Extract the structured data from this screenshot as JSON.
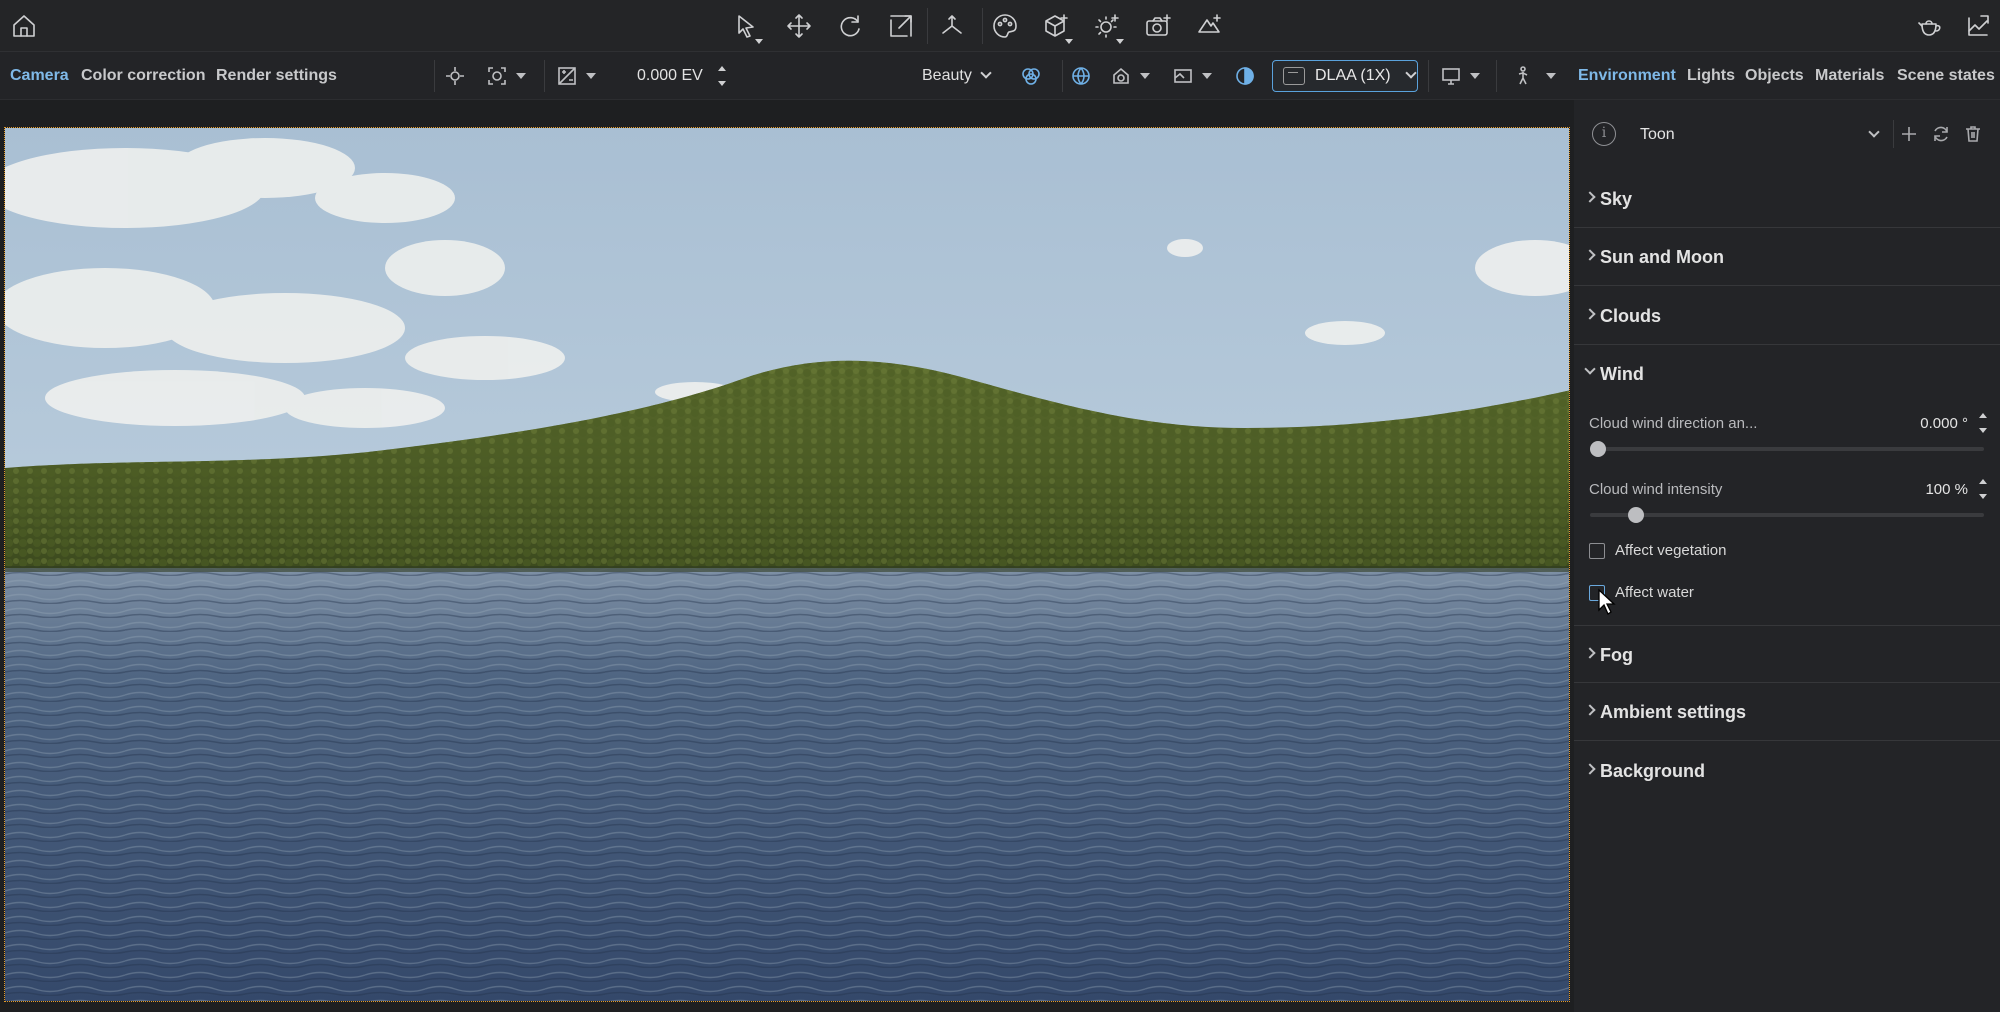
{
  "top_toolbar": {
    "icons": [
      "home-icon",
      "select-icon",
      "move-icon",
      "rotate-icon",
      "scale-icon",
      "transform-icon",
      "palette-icon",
      "add-object-icon",
      "add-light-icon",
      "add-camera-icon",
      "add-tree-icon",
      "teapot-icon",
      "image-edit-icon"
    ]
  },
  "left_tabs": [
    "Camera",
    "Color correction",
    "Render settings"
  ],
  "viewport_bar": {
    "exposure": "0.000 EV",
    "render_mode": "Beauty",
    "antialiasing": "DLAA (1X)"
  },
  "right_tabs": [
    "Environment",
    "Lights",
    "Objects",
    "Materials",
    "Scene states"
  ],
  "preset": {
    "name": "Toon"
  },
  "sections": [
    {
      "title": "Sky",
      "expanded": false
    },
    {
      "title": "Sun and Moon",
      "expanded": false
    },
    {
      "title": "Clouds",
      "expanded": false
    },
    {
      "title": "Wind",
      "expanded": true
    },
    {
      "title": "Fog",
      "expanded": false
    },
    {
      "title": "Ambient settings",
      "expanded": false
    },
    {
      "title": "Background",
      "expanded": false
    }
  ],
  "wind": {
    "direction_label": "Cloud wind direction an...",
    "direction_value": "0.000 °",
    "direction_fraction": 0.0,
    "intensity_label": "Cloud wind intensity",
    "intensity_value": "100 %",
    "intensity_fraction": 0.1,
    "affect_vegetation_label": "Affect vegetation",
    "affect_vegetation_checked": false,
    "affect_water_label": "Affect water",
    "affect_water_checked": false
  },
  "colors": {
    "accent": "#7fb9e8",
    "selection_border": "#e39a2a",
    "panel_bg": "#232427"
  }
}
